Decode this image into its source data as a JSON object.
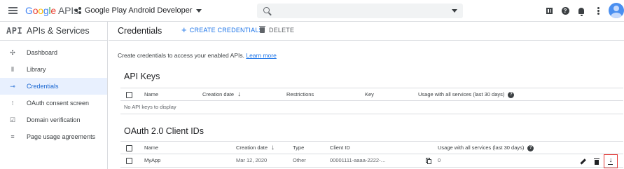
{
  "topbar": {
    "logo_letters": [
      "G",
      "o",
      "o",
      "g",
      "l",
      "e"
    ],
    "logo_suffix": "APIs",
    "project_name": "Google Play Android Developer",
    "search": {
      "value": "",
      "placeholder": ""
    },
    "icons": [
      "menu-icon",
      "gift-icon",
      "help-icon",
      "notifications-icon",
      "more-vert-icon",
      "account-avatar"
    ]
  },
  "sidebar": {
    "badge": "API",
    "title": "APIs & Services",
    "items": [
      {
        "label": "Dashboard",
        "icon": "dashboard-icon",
        "glyph": "✣"
      },
      {
        "label": "Library",
        "icon": "library-icon",
        "glyph": "⦀"
      },
      {
        "label": "Credentials",
        "icon": "key-icon",
        "glyph": "⊸",
        "active": true
      },
      {
        "label": "OAuth consent screen",
        "icon": "consent-icon",
        "glyph": "⁝"
      },
      {
        "label": "Domain verification",
        "icon": "domain-check-icon",
        "glyph": "☑"
      },
      {
        "label": "Page usage agreements",
        "icon": "settings-list-icon",
        "glyph": "≡"
      }
    ]
  },
  "main": {
    "title": "Credentials",
    "create_label": "CREATE CREDENTIALS",
    "delete_label": "DELETE",
    "intro_text": "Create credentials to access your enabled APIs.",
    "intro_link": "Learn more",
    "api_keys": {
      "title": "API Keys",
      "headers": {
        "name": "Name",
        "creation_date": "Creation date",
        "restrictions": "Restrictions",
        "key": "Key",
        "usage": "Usage with all services (last 30 days)"
      },
      "empty": "No API keys to display"
    },
    "oauth": {
      "title": "OAuth 2.0 Client IDs",
      "headers": {
        "name": "Name",
        "creation_date": "Creation date",
        "type": "Type",
        "client_id": "Client ID",
        "usage": "Usage with all services (last 30 days)"
      },
      "rows": [
        {
          "name": "MyApp",
          "creation_date": "Mar 12, 2020",
          "type": "Other",
          "client_id": "00001111-aaaa-2222-…",
          "usage": "0"
        }
      ]
    }
  },
  "colors": {
    "accent": "#1a73e8",
    "active_bg": "#e8f0fe",
    "highlight_border": "#e53935"
  }
}
